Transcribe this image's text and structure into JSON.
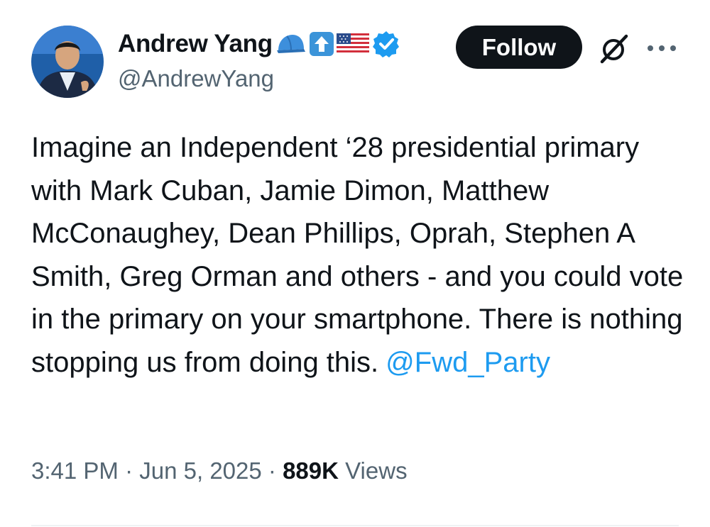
{
  "author": {
    "display_name": "Andrew Yang",
    "handle": "@AndrewYang",
    "badges": [
      "blue-cap-icon",
      "up-arrow-icon",
      "us-flag-icon",
      "verified-badge-icon"
    ]
  },
  "actions": {
    "follow_label": "Follow"
  },
  "tweet": {
    "text": "Imagine an Independent ‘28 presidential primary with Mark Cuban, Jamie Dimon, Matthew McConaughey, Dean Phillips, Oprah, Stephen A Smith, Greg Orman and others - and you could vote in the primary on your smartphone. There is nothing stopping us from doing this.",
    "mention": "@Fwd_Party"
  },
  "meta": {
    "time": "3:41 PM",
    "separator": "·",
    "date": "Jun 5, 2025",
    "views_count": "889K",
    "views_label": "Views"
  },
  "colors": {
    "text": "#0f1419",
    "secondary": "#536471",
    "link": "#1d9bf0",
    "button_bg": "#0f1419"
  }
}
